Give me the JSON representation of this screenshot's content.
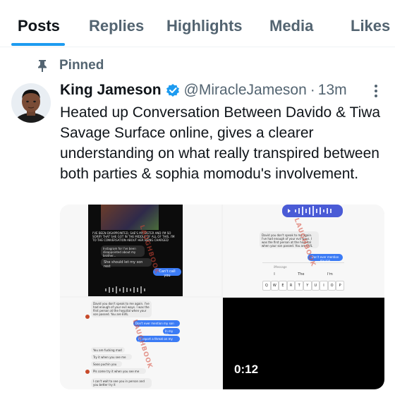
{
  "tabs": [
    {
      "label": "Posts",
      "active": true
    },
    {
      "label": "Replies",
      "active": false
    },
    {
      "label": "Highlights",
      "active": false
    },
    {
      "label": "Media",
      "active": false
    },
    {
      "label": "Likes",
      "active": false
    }
  ],
  "pinned": {
    "label": "Pinned",
    "icon": "pin-icon"
  },
  "tweet": {
    "author_name": "King Jameson",
    "verified": true,
    "handle": "@MiracleJameson",
    "separator": "·",
    "time": "13m",
    "text": "Heated up Conversation Between Davido & Tiwa Savage Surface online, gives a clearer understanding on what really transpired between both parties & sophia momodu's involvement."
  },
  "media": {
    "shot1": {
      "caption_lines": "I'VE BEEN DISAPPOINTED, SHE'S MY SISTER AND I'M SO SORRY THAT SHE GOT IN THE MIDDLE OF ALL OF THIS, I'M TO THE CONVERSATION ABOUT HER BEING CHARGED",
      "msg1": "Instagram for I've been disappointed about my brother...",
      "msg2": "She should let my son rest",
      "msg3": "Can't call you"
    },
    "shot2": {
      "msg1": "David you don't speak to me again. I've had enough of your evil ways. I was the first person at the hospital when your son passed. You are EVIL",
      "msg2": "Don't ever mention my son",
      "compose_placeholder": "iMessage",
      "suggestions": [
        "I",
        "The",
        "I'm"
      ],
      "keys": [
        "Q",
        "W",
        "E",
        "R",
        "T",
        "Y",
        "U",
        "I",
        "O",
        "P"
      ]
    },
    "shot3": {
      "msg1": "David you don't speak to me again. I've had enough of your evil ways. I was the first person at the hospital when your son passed. You are EVIL",
      "msg2": "Don't ever mention my son",
      "msg3": "In my life",
      "msg4": "I'll report a threat on my life",
      "msg5": "You are fucking mad",
      "msg6": "Try it when you see me",
      "msg7": "Sooo puchin you",
      "msg8": "Pls come try it when you see me",
      "msg9": "I can't wait to see you in person and you better try it"
    },
    "video": {
      "duration": "0:12"
    }
  },
  "colors": {
    "accent": "#1d9bf0",
    "text_primary": "#0f1419",
    "text_secondary": "#536471",
    "imessage_blue": "#3b7bf5"
  }
}
